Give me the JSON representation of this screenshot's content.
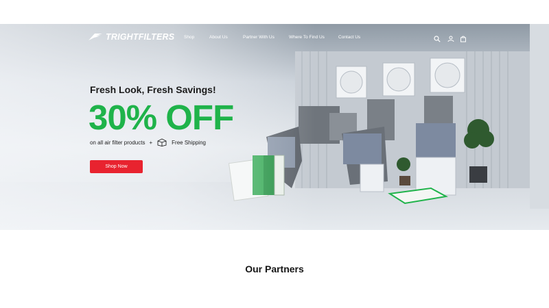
{
  "brand": {
    "logo_text": "TRIGHTFILTERS"
  },
  "nav": {
    "items": [
      "Shop",
      "About Us",
      "Partner With Us",
      "Where To Find Us",
      "Contact Us"
    ]
  },
  "header_icons": [
    "search-icon",
    "account-icon",
    "cart-icon"
  ],
  "hero": {
    "subtitle": "Fresh Look, Fresh Savings!",
    "headline": "30% OFF",
    "line_text": "on all air filter products",
    "plus": "+",
    "shipping_text": "Free Shipping",
    "cta": "Shop Now",
    "accent_color": "#1fb34a",
    "cta_color": "#e8232f"
  },
  "partners": {
    "title": "Our Partners"
  }
}
